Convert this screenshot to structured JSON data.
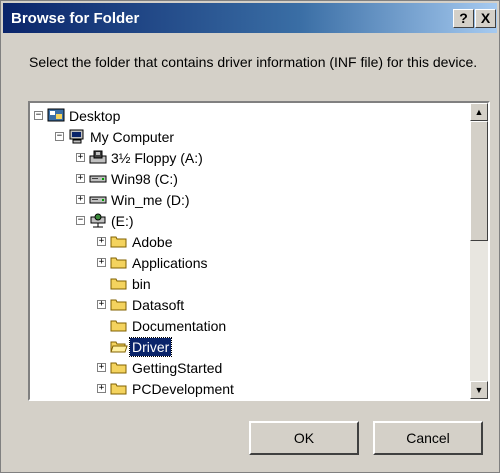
{
  "window": {
    "title": "Browse for Folder",
    "help_label": "?",
    "close_label": "X"
  },
  "instructions": "Select the folder that contains driver information (INF file) for this device.",
  "tree": {
    "items": [
      {
        "label": "Desktop",
        "icon": "desktop-icon",
        "expander": "−",
        "level": 0,
        "selected": false
      },
      {
        "label": "My Computer",
        "icon": "computer-icon",
        "expander": "−",
        "level": 1,
        "selected": false
      },
      {
        "label": "3½ Floppy (A:)",
        "icon": "floppy-drive-icon",
        "expander": "+",
        "level": 2,
        "selected": false
      },
      {
        "label": "Win98 (C:)",
        "icon": "hard-drive-icon",
        "expander": "+",
        "level": 2,
        "selected": false
      },
      {
        "label": "Win_me (D:)",
        "icon": "hard-drive-icon",
        "expander": "+",
        "level": 2,
        "selected": false
      },
      {
        "label": "(E:)",
        "icon": "network-drive-icon",
        "expander": "−",
        "level": 2,
        "selected": false
      },
      {
        "label": "Adobe",
        "icon": "folder-icon",
        "expander": "+",
        "level": 3,
        "selected": false
      },
      {
        "label": "Applications",
        "icon": "folder-icon",
        "expander": "+",
        "level": 3,
        "selected": false
      },
      {
        "label": "bin",
        "icon": "folder-icon",
        "expander": "",
        "level": 3,
        "selected": false
      },
      {
        "label": "Datasoft",
        "icon": "folder-icon",
        "expander": "+",
        "level": 3,
        "selected": false
      },
      {
        "label": "Documentation",
        "icon": "folder-icon",
        "expander": "",
        "level": 3,
        "selected": false
      },
      {
        "label": "Driver",
        "icon": "open-folder-icon",
        "expander": "",
        "level": 3,
        "selected": true
      },
      {
        "label": "GettingStarted",
        "icon": "folder-icon",
        "expander": "+",
        "level": 3,
        "selected": false
      },
      {
        "label": "PCDevelopment",
        "icon": "folder-icon",
        "expander": "+",
        "level": 3,
        "selected": false
      }
    ]
  },
  "scrollbar": {
    "up_glyph": "▲",
    "down_glyph": "▼"
  },
  "buttons": {
    "ok": "OK",
    "cancel": "Cancel"
  },
  "colors": {
    "title_start": "#0a246a",
    "title_end": "#a6caf0",
    "dialog_face": "#d4d0c8",
    "selection": "#0a246a",
    "folder": "#f4d35e"
  }
}
